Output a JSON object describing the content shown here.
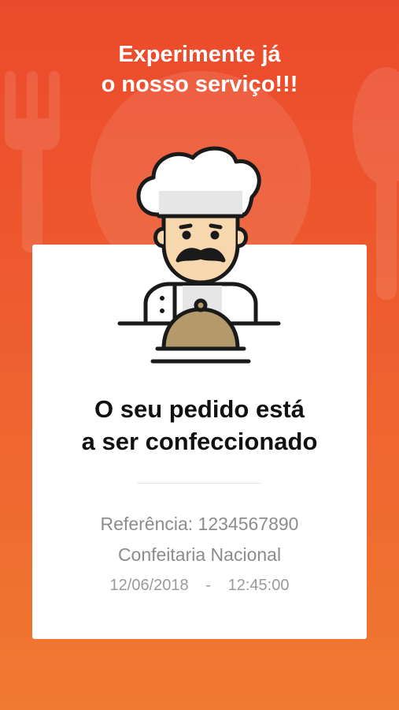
{
  "headline": {
    "line1": "Experimente já",
    "line2": "o nosso serviço!!!"
  },
  "order": {
    "title_line1": "O seu pedido está",
    "title_line2": "a ser confeccionado",
    "reference": "Referência: 1234567890",
    "store": "Confeitaria Nacional",
    "date": "12/06/2018",
    "separator": "-",
    "time": "12:45:00"
  },
  "icons": {
    "chef": "chef-with-cloche-icon",
    "fork": "fork-icon",
    "plate": "plate-icon",
    "spoon": "spoon-icon"
  },
  "colors": {
    "background_top": "#ec4a2c",
    "background_bottom": "#f07a31",
    "card": "#ffffff",
    "cloche": "#b49a6a"
  }
}
